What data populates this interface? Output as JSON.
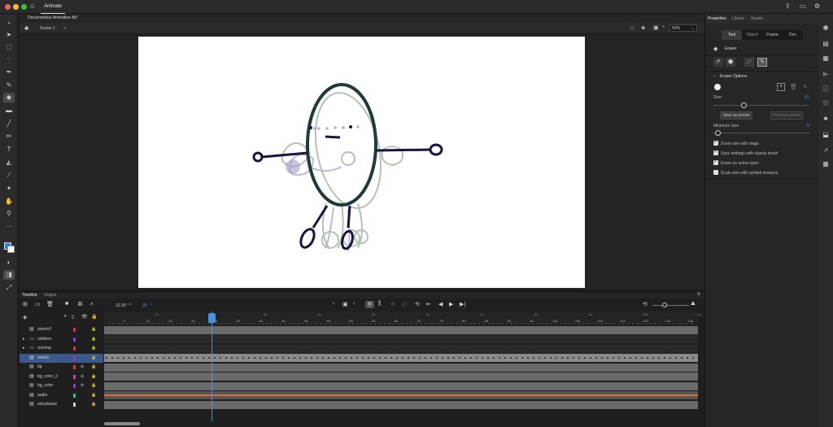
{
  "app": {
    "tab_label": "Animate"
  },
  "document": {
    "tab_title": "Documentary Animation.fla*"
  },
  "scene": {
    "name": "Scene 1",
    "zoom": "63%"
  },
  "properties_panel": {
    "tabs": [
      "Properties",
      "Library",
      "Assets"
    ],
    "subtabs": [
      "Tool",
      "Object",
      "Frame",
      "Doc"
    ],
    "tool_name": "Eraser",
    "section_title": "Eraser Options",
    "size_label": "Size",
    "size_value": "61",
    "save_preset": "Save as preset",
    "remove_preset": "Remove preset",
    "min_size_label": "Minimum Size",
    "min_size_value": "0",
    "options": [
      {
        "label": "Zoom size with stage",
        "checked": true
      },
      {
        "label": "Sync settings with classic brush",
        "checked": true
      },
      {
        "label": "Erase on active layer",
        "checked": true
      },
      {
        "label": "Scale size with symbol instance",
        "checked": false
      }
    ]
  },
  "timeline": {
    "tabs": [
      "Timeline",
      "Output"
    ],
    "fps": "12.00",
    "fps_unit": "FPS",
    "current_frame": "25",
    "frame_numbers": [
      "5",
      "10",
      "15",
      "20",
      "25",
      "30",
      "35",
      "40",
      "45",
      "50",
      "55",
      "60",
      "65",
      "70",
      "75",
      "80",
      "85",
      "90",
      "95",
      "100",
      "105",
      "110",
      "115",
      "120",
      "125",
      "130"
    ],
    "second_marks": [
      "1s",
      "2s",
      "3s",
      "4s",
      "5s",
      "6s",
      "7s",
      "8s",
      "9s",
      "10s",
      "11s"
    ],
    "layers": [
      {
        "name": "sketch2",
        "color": "#d13a3a",
        "type": "layer"
      },
      {
        "name": "children",
        "color": "#8a3fd1",
        "type": "folder"
      },
      {
        "name": "running",
        "color": "#d13a3a",
        "type": "folder"
      },
      {
        "name": "sketch",
        "color": "#8a3fd1",
        "type": "layer",
        "selected": true
      },
      {
        "name": "bg",
        "color": "#d13a3a",
        "type": "layer"
      },
      {
        "name": "bg_color_2",
        "color": "#d13ac8",
        "type": "layer"
      },
      {
        "name": "bg_color",
        "color": "#8a3fd1",
        "type": "layer"
      },
      {
        "name": "audio",
        "color": "#2fbfa0",
        "type": "audio"
      },
      {
        "name": "storyboard",
        "color": "#cfcfcf",
        "type": "layer"
      }
    ]
  },
  "colors": {
    "accent": "#2680eb",
    "selected_layer": "#3b5a8a",
    "playhead": "#4a8fe0",
    "audio_wave": "#e06a3a"
  }
}
